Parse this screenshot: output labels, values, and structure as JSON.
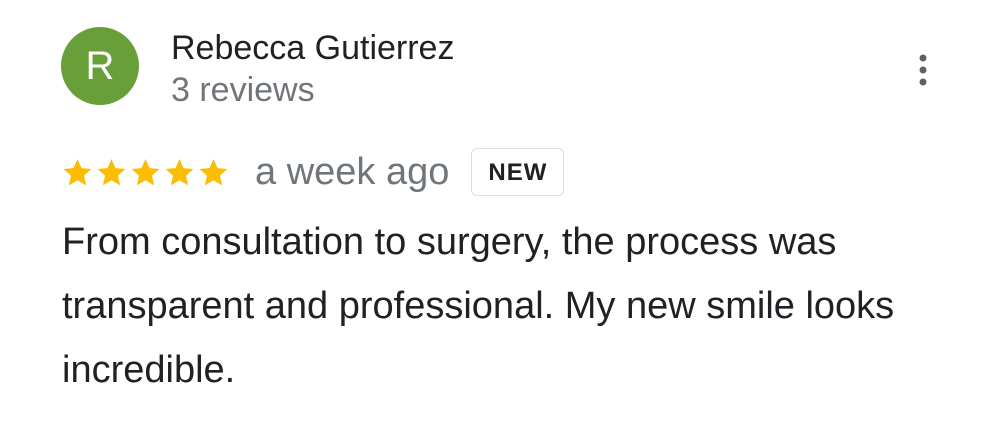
{
  "reviewer": {
    "avatar_initial": "R",
    "avatar_color": "#689f38",
    "name": "Rebecca Gutierrez",
    "review_count": "3 reviews"
  },
  "menu": {
    "icon": "more-vert-icon"
  },
  "review": {
    "rating": 5,
    "max_rating": 5,
    "star_color": "#fbbc04",
    "date": "a week ago",
    "badge": "NEW",
    "text": "From consultation to surgery, the process was transparent and professional. My new smile looks incredible."
  }
}
